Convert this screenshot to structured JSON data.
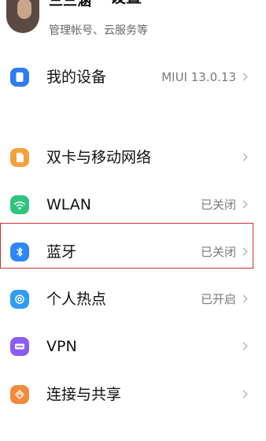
{
  "header": {
    "title": "设置"
  },
  "account": {
    "name": "三三涵",
    "subtitle": "管理帐号、云服务等"
  },
  "items": [
    {
      "label": "我的设备",
      "value": "MIUI 13.0.13",
      "icon": "device-icon",
      "color": "#2f7bf5"
    },
    {
      "label": "双卡与移动网络",
      "value": "",
      "icon": "sim-card-icon",
      "color": "#f5a13d"
    },
    {
      "label": "WLAN",
      "value": "已关闭",
      "icon": "wifi-icon",
      "color": "#2fc47e"
    },
    {
      "label": "蓝牙",
      "value": "已关闭",
      "icon": "bluetooth-icon",
      "color": "#2f86f5"
    },
    {
      "label": "个人热点",
      "value": "已开启",
      "icon": "hotspot-icon",
      "color": "#2f9cf5"
    },
    {
      "label": "VPN",
      "value": "",
      "icon": "vpn-icon",
      "color": "#8a5cf5"
    },
    {
      "label": "连接与共享",
      "value": "",
      "icon": "connection-share-icon",
      "color": "#f58a3d"
    }
  ],
  "highlight": {
    "color": "#d32f2f",
    "target": "蓝牙"
  }
}
